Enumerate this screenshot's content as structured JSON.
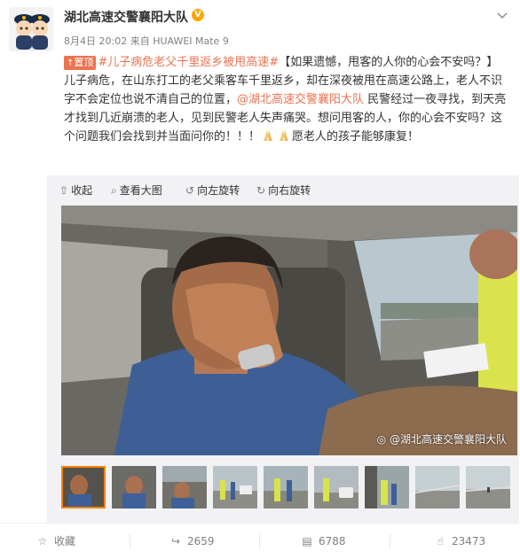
{
  "post": {
    "author": "湖北高速交警襄阳大队",
    "verified_badge": "V",
    "time": "8月4日 20:02",
    "source_prefix": "来自",
    "source": "HUAWEI Mate 9",
    "pinned_label": "置顶",
    "text": {
      "hashtag": "#儿子病危老父千里返乡被甩高速#",
      "part1": "【如果遗憾，甩客的人你的心会不安吗？】儿子病危，在山东打工的老父乘客车千里返乡，却在深夜被甩在高速公路上，老人不识字不会定位也说不清自己的位置，",
      "mention": "@湖北高速交警襄阳大队",
      "part2": " 民警经过一夜寻找，到天亮才找到几近崩溃的老人，见到民警老人失声痛哭。想问甩客的人，你的心会不安吗？这个问题我们会找到并当面问你的！！！",
      "part3": "愿老人的孩子能够康复！"
    }
  },
  "media_toolbar": {
    "collapse": "收起",
    "view_large": "查看大图",
    "rotate_left": "向左旋转",
    "rotate_right": "向右旋转"
  },
  "photo": {
    "watermark": "@湖北高速交警襄阳大队"
  },
  "actions": {
    "favorite": "收藏",
    "repost": "2659",
    "comment": "6788",
    "like": "23473"
  },
  "colors": {
    "accent": "#eb7350",
    "thumb_selected": "#ff8200"
  }
}
